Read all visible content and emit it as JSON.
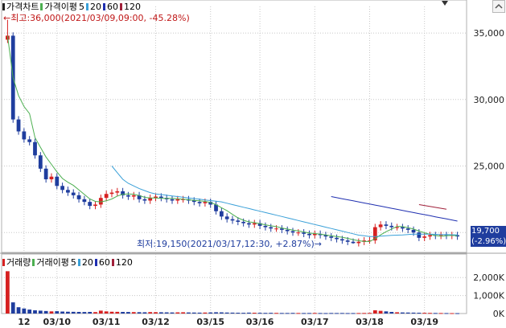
{
  "legend_top": {
    "items": [
      {
        "label": "가격차트",
        "color": "#222222"
      },
      {
        "label": "가격이평",
        "color": "#4caf50"
      },
      {
        "label": "5",
        "color": "#4caf50"
      },
      {
        "label": "20",
        "color": "#3aa0d8"
      },
      {
        "label": "60",
        "color": "#1f2fb0"
      },
      {
        "label": "120",
        "color": "#a0203a"
      }
    ]
  },
  "legend_bottom": {
    "items": [
      {
        "label": "거래량",
        "color": "#d62020"
      },
      {
        "label": "거래이평",
        "color": "#4caf50"
      },
      {
        "label": "5",
        "color": "#4caf50"
      },
      {
        "label": "20",
        "color": "#3aa0d8"
      },
      {
        "label": "60",
        "color": "#1f2fb0"
      },
      {
        "label": "120",
        "color": "#a0203a"
      }
    ]
  },
  "annotations": {
    "high": "←최고:36,000(2021/03/09,09:00, -45.28%)",
    "low": "최저:19,150(2021/03/17,12:30, +2.87%)→"
  },
  "current_price": {
    "value": "19,700",
    "change": "(-2.96%)"
  },
  "colors": {
    "up": "#d62020",
    "down": "#1f3d9e",
    "ma5": "#4caf50",
    "ma20": "#3aa0d8",
    "ma60": "#1f2fb0",
    "ma120": "#a0203a",
    "grid": "#c8c8c8"
  },
  "chart_data": {
    "type": "candlestick",
    "price_axis": {
      "ticks": [
        "35,000",
        "30,000",
        "25,000",
        "20,000"
      ],
      "values": [
        35000,
        30000,
        25000,
        20000
      ],
      "range": [
        18500,
        37000
      ]
    },
    "volume_axis": {
      "ticks": [
        "2,000K",
        "1,000K",
        "0K"
      ],
      "values": [
        2000,
        1000,
        0
      ],
      "range": [
        0,
        2500
      ]
    },
    "x_axis": {
      "ticks": [
        "12",
        "03/10",
        "03/11",
        "03/12",
        "03/15",
        "03/16",
        "03/17",
        "03/18",
        "03/19"
      ]
    },
    "close": [
      34800,
      28500,
      27600,
      27000,
      26800,
      25800,
      24800,
      24000,
      24200,
      23500,
      23200,
      23000,
      22800,
      22500,
      22300,
      22000,
      22100,
      22600,
      22900,
      23000,
      23100,
      22800,
      22700,
      22800,
      22500,
      22400,
      22600,
      22700,
      22600,
      22500,
      22400,
      22500,
      22500,
      22400,
      22300,
      22200,
      22300,
      22100,
      21600,
      21200,
      21000,
      20900,
      20800,
      20700,
      20600,
      20700,
      20500,
      20400,
      20300,
      20300,
      20200,
      20100,
      20000,
      20000,
      19900,
      19800,
      19900,
      19800,
      19700,
      19600,
      19500,
      19400,
      19300,
      19200,
      19300,
      19400,
      19400,
      20400,
      20600,
      20500,
      20400,
      20400,
      20300,
      20200,
      20000,
      19600,
      19700,
      19800,
      19750,
      19800,
      19750,
      19800,
      19700
    ],
    "high_mark": 36000,
    "low_mark": 19150,
    "volume_k": [
      2350,
      620,
      350,
      280,
      220,
      180,
      160,
      140,
      120,
      130,
      110,
      100,
      95,
      90,
      85,
      90,
      80,
      160,
      120,
      100,
      95,
      90,
      85,
      80,
      75,
      70,
      80,
      75,
      70,
      65,
      60,
      65,
      70,
      60,
      55,
      50,
      55,
      60,
      70,
      65,
      55,
      50,
      45,
      40,
      50,
      45,
      40,
      35,
      40,
      35,
      30,
      30,
      35,
      30,
      28,
      30,
      32,
      28,
      25,
      30,
      28,
      30,
      25,
      26,
      28,
      30,
      35,
      180,
      150,
      120,
      90,
      70,
      60,
      55,
      50,
      45,
      40,
      35,
      30,
      28,
      25,
      22,
      20
    ],
    "ma5": [
      34800,
      31650,
      30300,
      29475,
      28940,
      27140,
      26400,
      25680,
      25120,
      24560,
      24060,
      23780,
      23540,
      23200,
      22860,
      22520,
      22340,
      22300,
      22380,
      22520,
      22740,
      22880,
      22900,
      22880,
      22780,
      22640,
      22600,
      22600,
      22560,
      22560,
      22560,
      22540,
      22500,
      22460,
      22420,
      22380,
      22340,
      22260,
      22100,
      21860,
      21640,
      21360,
      21100,
      20920,
      20800,
      20740,
      20660,
      20580,
      20500,
      20440,
      20340,
      20260,
      20180,
      20120,
      20040,
      19960,
      19920,
      19880,
      19820,
      19760,
      19700,
      19640,
      19560,
      19460,
      19380,
      19320,
      19320,
      19540,
      19820,
      20060,
      20260,
      20460,
      20440,
      20360,
      20260,
      20100,
      19980,
      19860,
      19770,
      19730,
      19760,
      19780,
      19760
    ],
    "ma20": [
      null,
      null,
      null,
      null,
      null,
      null,
      null,
      null,
      null,
      null,
      null,
      null,
      null,
      null,
      null,
      null,
      null,
      null,
      null,
      25000,
      24500,
      24000,
      23700,
      23500,
      23300,
      23150,
      23000,
      22900,
      22850,
      22800,
      22750,
      22700,
      22650,
      22600,
      22550,
      22500,
      22450,
      22400,
      22350,
      22300,
      22200,
      22100,
      22000,
      21900,
      21800,
      21700,
      21600,
      21500,
      21400,
      21300,
      21200,
      21100,
      21000,
      20900,
      20800,
      20700,
      20600,
      20500,
      20400,
      20300,
      20200,
      20100,
      20000,
      19900,
      19800,
      19750,
      19700,
      19700,
      19720,
      19750,
      19780,
      19800,
      19820,
      19850,
      19870,
      19880,
      19880,
      19870,
      19860,
      19850,
      19840,
      19830,
      19820
    ],
    "ma60": [
      null,
      null,
      null,
      null,
      null,
      null,
      null,
      null,
      null,
      null,
      null,
      null,
      null,
      null,
      null,
      null,
      null,
      null,
      null,
      null,
      null,
      null,
      null,
      null,
      null,
      null,
      null,
      null,
      null,
      null,
      null,
      null,
      null,
      null,
      null,
      null,
      null,
      null,
      null,
      null,
      null,
      null,
      null,
      null,
      null,
      null,
      null,
      null,
      null,
      null,
      null,
      null,
      null,
      null,
      null,
      null,
      null,
      null,
      null,
      22700,
      22620,
      22540,
      22460,
      22380,
      22300,
      22220,
      22140,
      22060,
      21980,
      21900,
      21820,
      21740,
      21660,
      21580,
      21500,
      21420,
      21340,
      21260,
      21180,
      21100,
      21020,
      20940,
      20860
    ],
    "ma120": [
      21900,
      21800
    ]
  }
}
